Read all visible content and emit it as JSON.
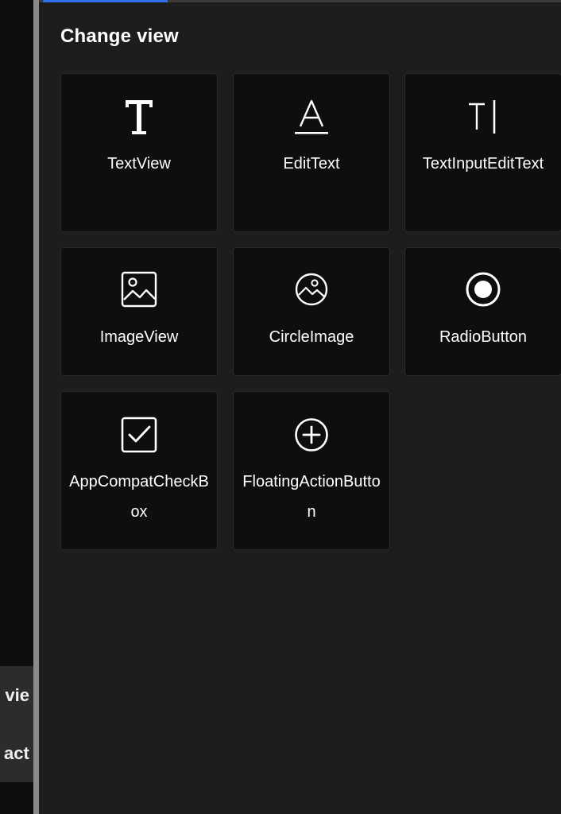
{
  "left_menu": {
    "items": [
      {
        "label": "e vie"
      },
      {
        "label": "act"
      }
    ]
  },
  "panel": {
    "title": "Change view",
    "accent_color": "#2f6fe8",
    "cards": [
      {
        "label": "TextView",
        "icon": "text-t-icon"
      },
      {
        "label": "EditText",
        "icon": "text-a-underline-icon"
      },
      {
        "label": "TextInputEditText",
        "icon": "text-cursor-icon"
      },
      {
        "label": "ImageView",
        "icon": "image-icon"
      },
      {
        "label": "CircleImage",
        "icon": "circle-image-icon"
      },
      {
        "label": "RadioButton",
        "icon": "radio-button-icon"
      },
      {
        "label": "AppCompatCheckBox",
        "icon": "checkbox-icon"
      },
      {
        "label": "FloatingActionButton",
        "icon": "plus-circle-icon"
      }
    ]
  }
}
